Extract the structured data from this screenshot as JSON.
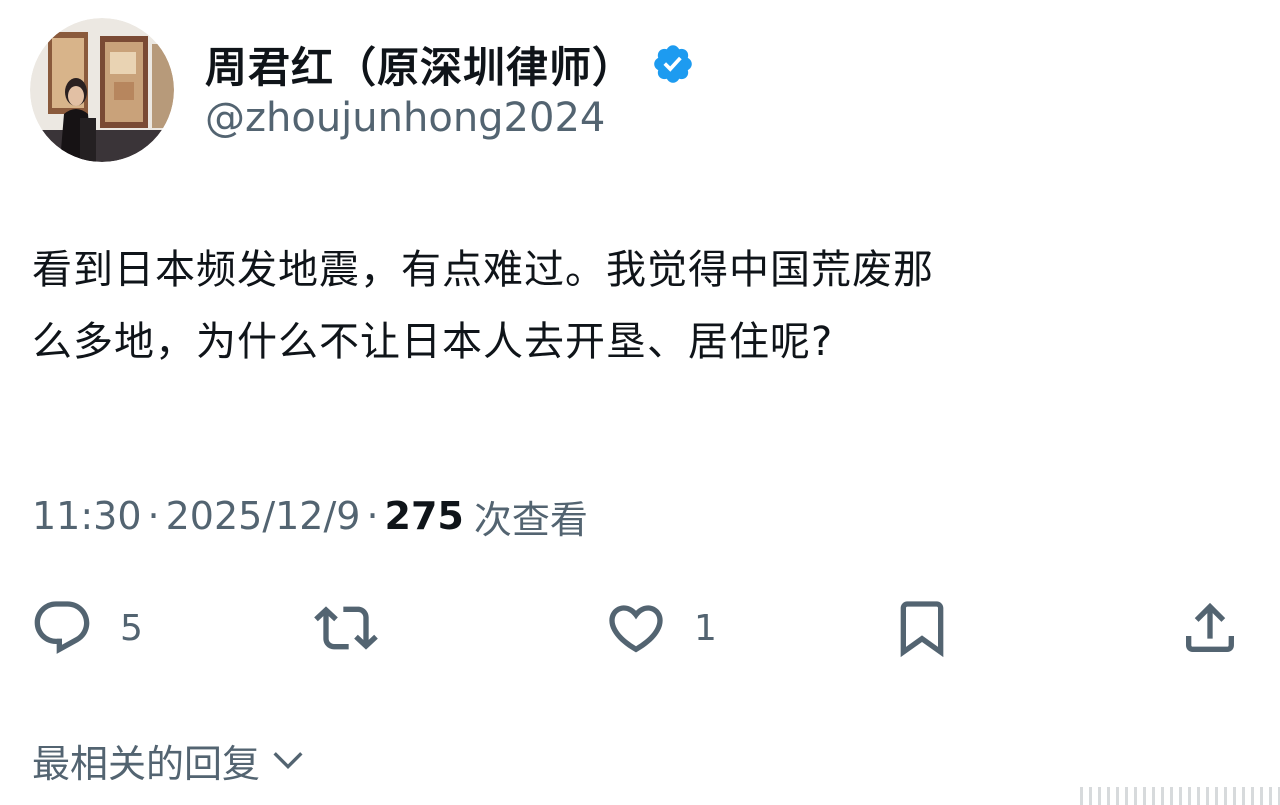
{
  "author": {
    "display_name": "周君红（原深圳律师）",
    "handle": "@zhoujunhong2024",
    "verified": true
  },
  "tweet": {
    "lines": [
      "看到日本频发地震，有点难过。我觉得中国荒废那",
      "么多地，为什么不让日本人去开垦、居住呢?"
    ],
    "time": "11:30",
    "separator": "·",
    "date": "2025/12/9",
    "views_count": "275",
    "views_label": "次查看"
  },
  "actions": {
    "reply_count": "5",
    "like_count": "1",
    "icons": [
      "reply-icon",
      "retweet-icon",
      "like-icon",
      "bookmark-icon",
      "share-icon"
    ]
  },
  "replies": {
    "sort_label": "最相关的回复"
  },
  "colors": {
    "text_primary": "#0f1419",
    "text_secondary": "#536471",
    "verified_blue": "#1d9bf0",
    "background": "#ffffff"
  }
}
